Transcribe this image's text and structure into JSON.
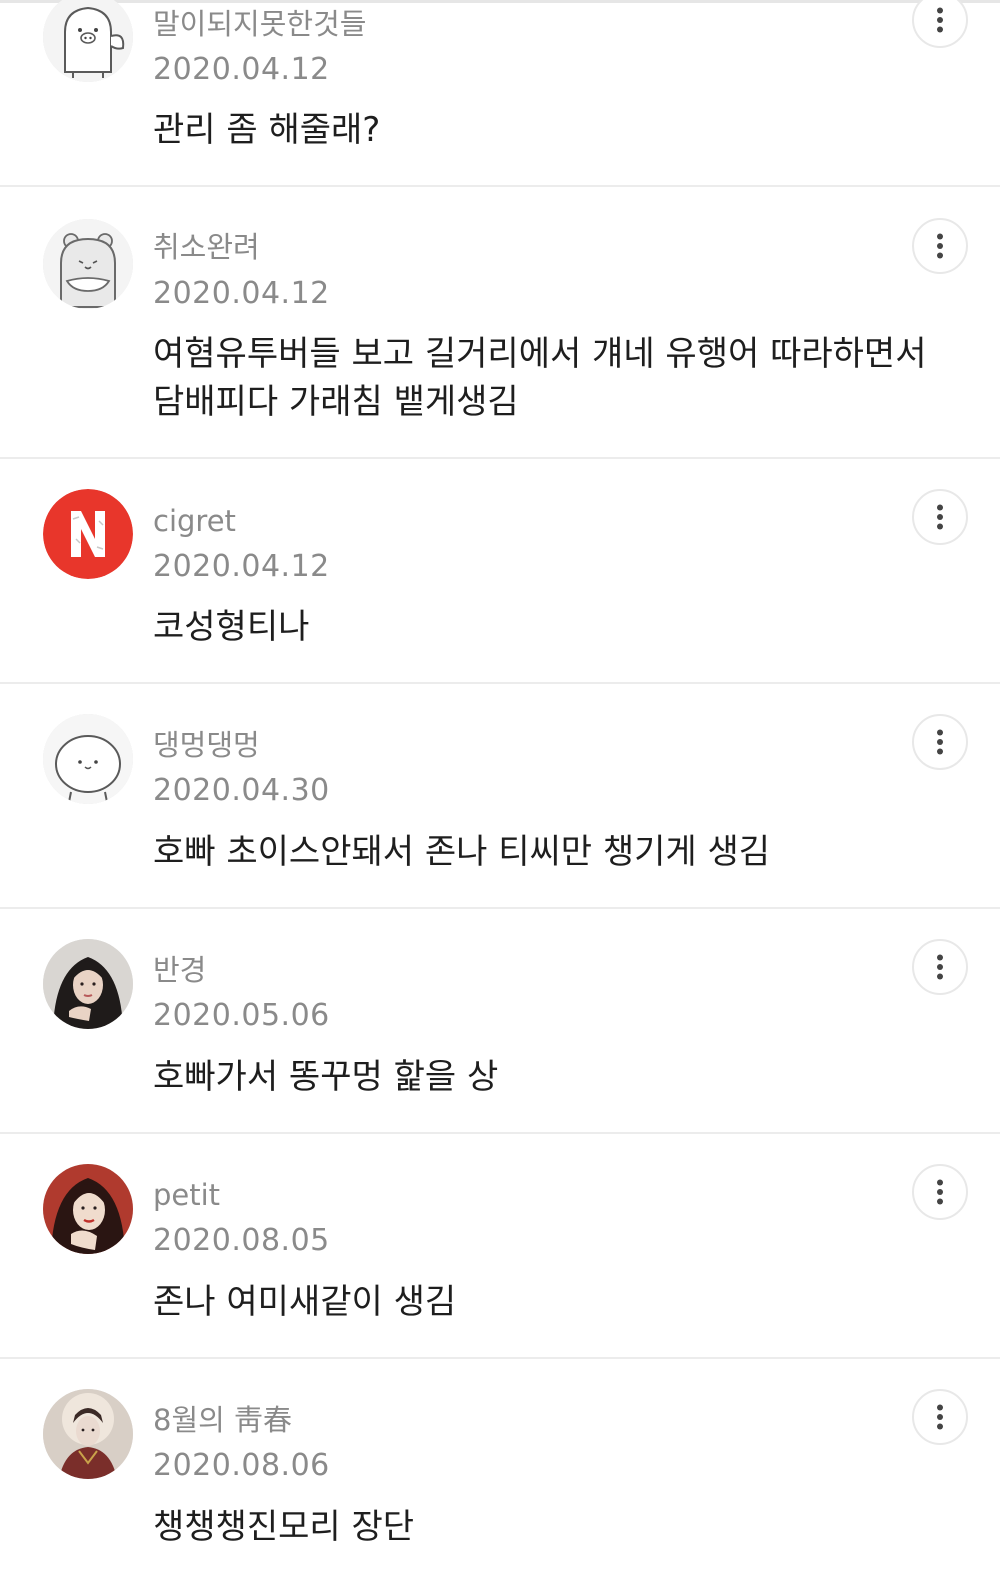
{
  "comments": [
    {
      "username": "말이되지못한것들",
      "date": "2020.04.12",
      "text": "관리 좀 해줄래?",
      "avatar_icon": "pig-character-icon"
    },
    {
      "username": "취소완려",
      "date": "2020.04.12",
      "text": "여혐유투버들 보고 길거리에서 걔네 유행어 따라하면서 담배피다 가래침 뱉게생김",
      "avatar_icon": "bear-character-icon"
    },
    {
      "username": "cigret",
      "date": "2020.04.12",
      "text": "코성형티나",
      "avatar_icon": "red-n-logo-icon",
      "avatar_letter": "N",
      "avatar_color": "#e8362b"
    },
    {
      "username": "댕멍댕멍",
      "date": "2020.04.30",
      "text": "호빠 초이스안돼서 존나 티씨만 챙기게 생김",
      "avatar_icon": "round-face-character-icon"
    },
    {
      "username": "반경",
      "date": "2020.05.06",
      "text": "호빠가서 똥꾸멍 핥을 상",
      "avatar_icon": "portrait-photo-icon"
    },
    {
      "username": "petit",
      "date": "2020.08.05",
      "text": "존나 여미새같이 생김",
      "avatar_icon": "portrait-photo-icon"
    },
    {
      "username": "8월의 靑春",
      "date": "2020.08.06",
      "text": "챙챙챙진모리 장단",
      "avatar_icon": "portrait-photo-icon"
    }
  ],
  "more_icon": "vertical-ellipsis-icon",
  "colors": {
    "meta_text": "#8a8a8a",
    "body_text": "#1e1e1e",
    "divider": "#ececec"
  }
}
